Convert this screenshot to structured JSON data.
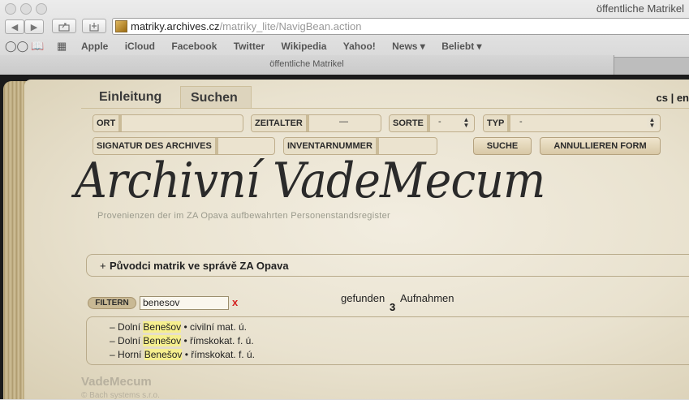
{
  "window": {
    "title": "öffentliche Matrikel"
  },
  "toolbar": {
    "back": "◀",
    "forward": "▶"
  },
  "address": {
    "domain": "matriky.archives.cz",
    "path": "/matriky_lite/NavigBean.action"
  },
  "bookmarks": [
    "Apple",
    "iCloud",
    "Facebook",
    "Twitter",
    "Wikipedia",
    "Yahoo!",
    "News ▾",
    "Beliebt ▾"
  ],
  "tab": {
    "title": "öffentliche Matrikel"
  },
  "nav": {
    "intro": "Einleitung",
    "search": "Suchen"
  },
  "lang": {
    "cs": "cs",
    "sep": "|",
    "en": "en"
  },
  "form": {
    "ort_label": "ORT",
    "zeitalter_label": "ZEITALTER",
    "zeitalter_value": "—",
    "sorte_label": "SORTE",
    "sorte_value": "-",
    "typ_label": "TYP",
    "typ_value": "-",
    "signatur_label": "SIGNATUR DES ARCHIVES",
    "inventar_label": "INVENTARNUMMER",
    "search_button": "SUCHE",
    "reset_button": "ANNULLIEREN FORM"
  },
  "logo": {
    "title": "Archivní VadeMecum",
    "subtitle": "Provenienzen der im ZA Opava aufbewahrten Personenstandsregister"
  },
  "accordion": {
    "plus": "+",
    "title": "Původci matrik ve správě ZA Opava"
  },
  "filter": {
    "button": "FILTERN",
    "value": "benesov",
    "clear": "x"
  },
  "found": {
    "prefix": "gefunden",
    "count": "3",
    "suffix": "Aufnahmen"
  },
  "results": [
    {
      "dash": "–",
      "pre": "Dolní",
      "hl": "Benešov",
      "post": "• civilní mat. ú."
    },
    {
      "dash": "–",
      "pre": "Dolní",
      "hl": "Benešov",
      "post": "• římskokat. f. ú."
    },
    {
      "dash": "–",
      "pre": "Horní",
      "hl": "Benešov",
      "post": "• římskokat. f. ú."
    }
  ],
  "footer": {
    "brand": "VadeMecum",
    "copyright": "© Bach systems s.r.o."
  }
}
